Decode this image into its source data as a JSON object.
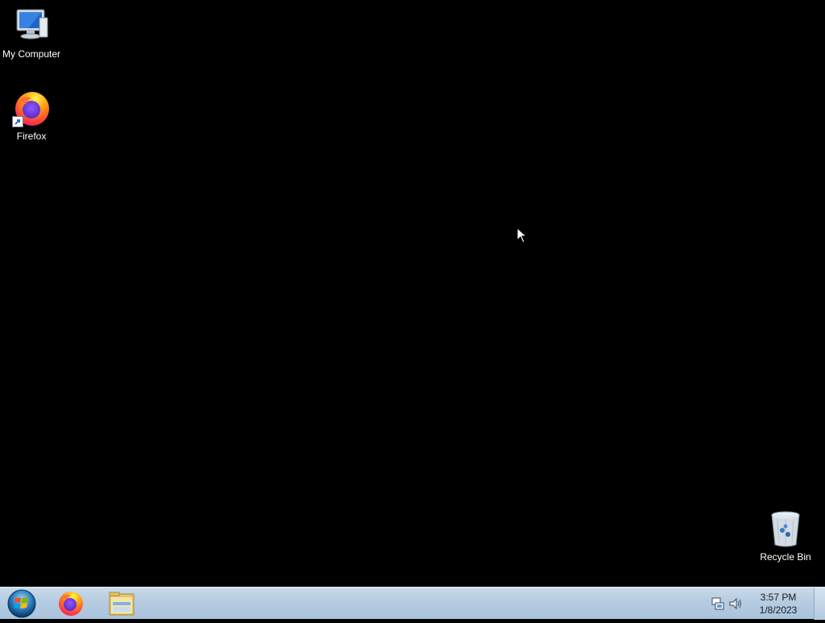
{
  "desktop": {
    "icons": [
      {
        "label": "My Computer",
        "icon": "computer-icon"
      },
      {
        "label": "Firefox",
        "icon": "firefox-icon"
      },
      {
        "label": "Recycle Bin",
        "icon": "recycle-bin-icon"
      }
    ]
  },
  "taskbar": {
    "start_icon": "windows-logo-icon",
    "pinned": [
      {
        "icon": "firefox-icon"
      },
      {
        "icon": "folder-icon"
      }
    ],
    "tray": {
      "network_icon": "network-icon",
      "volume_icon": "speaker-icon",
      "time": "3:57 PM",
      "date": "1/8/2023"
    }
  },
  "colors": {
    "desktop_background": "#000000",
    "taskbar": "#b7cde2"
  }
}
